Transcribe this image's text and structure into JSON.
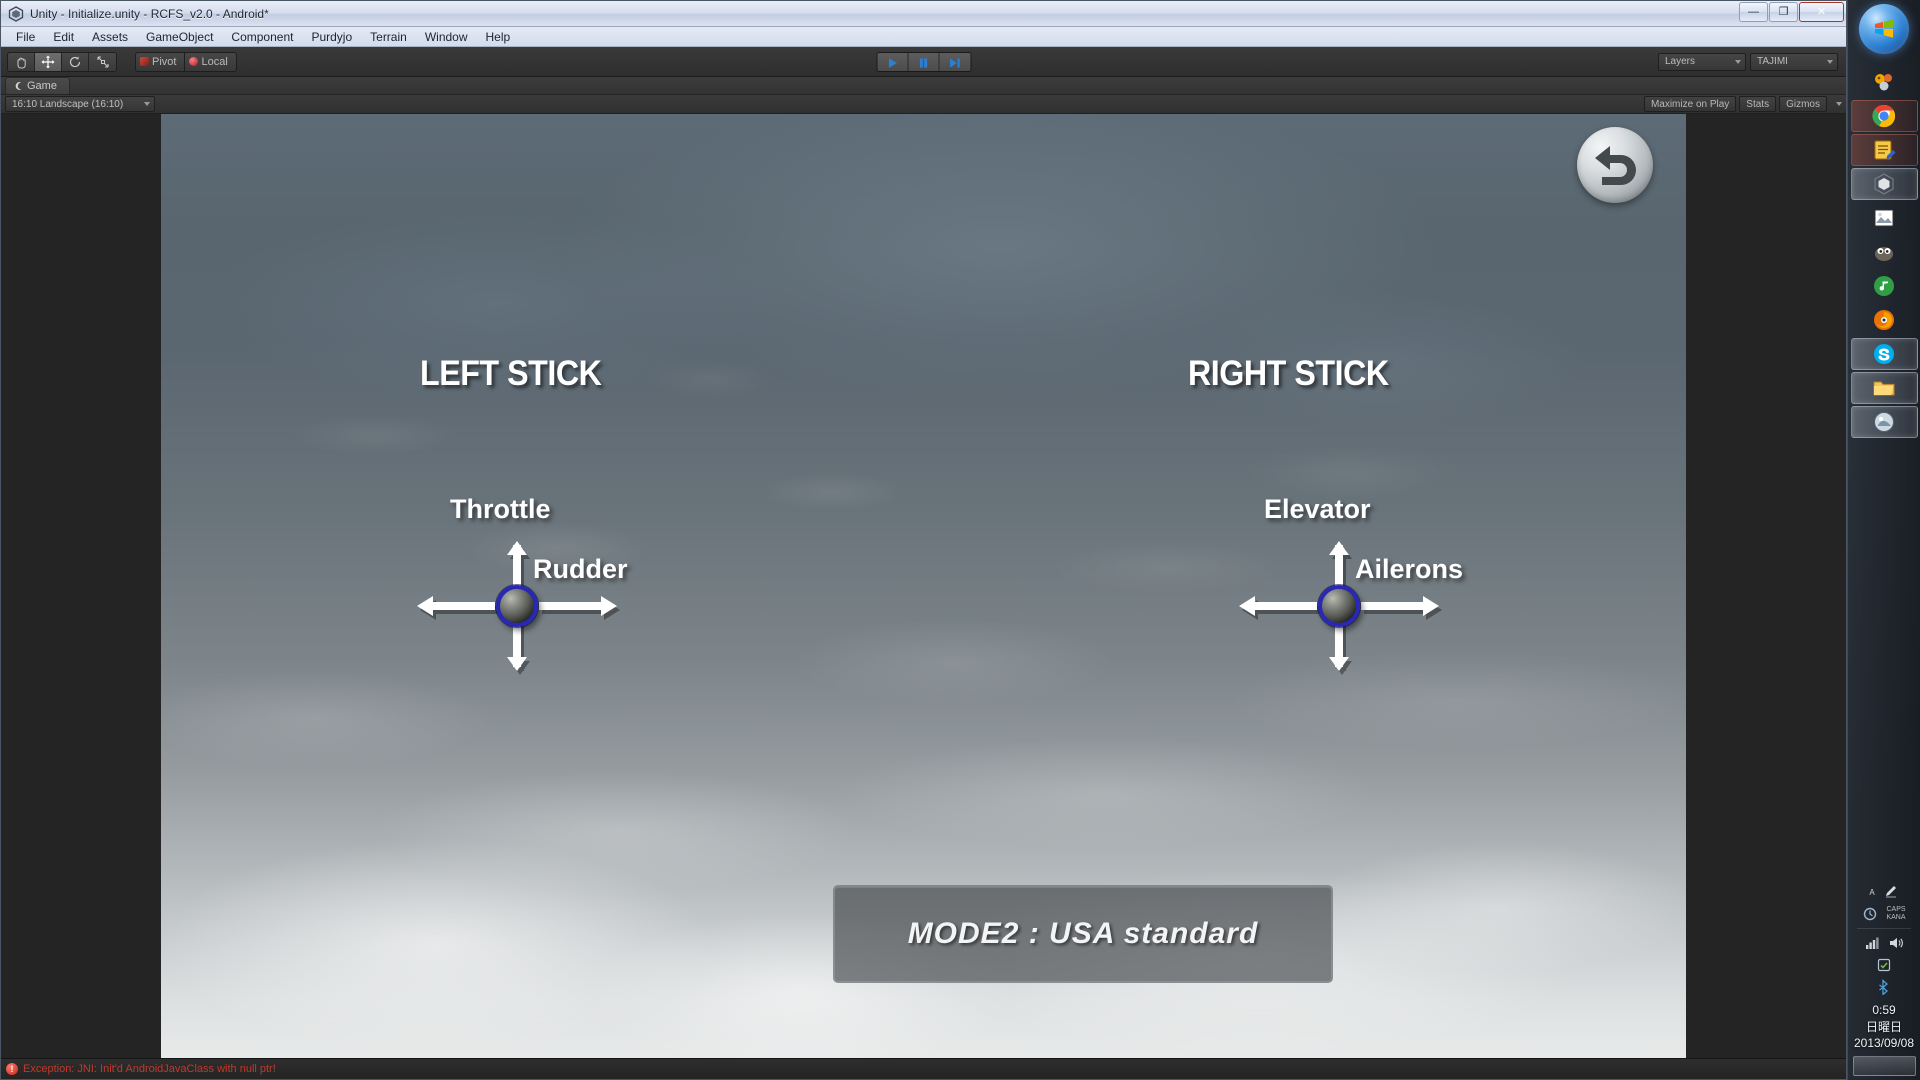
{
  "window": {
    "title": "Unity - Initialize.unity - RCFS_v2.0 - Android*",
    "icon": "unity-logo-icon",
    "minimize_label": "—",
    "maximize_label": "❐",
    "close_label": "✕"
  },
  "menu": {
    "items": [
      {
        "label": "File"
      },
      {
        "label": "Edit"
      },
      {
        "label": "Assets"
      },
      {
        "label": "GameObject"
      },
      {
        "label": "Component"
      },
      {
        "label": "Purdyjo"
      },
      {
        "label": "Terrain"
      },
      {
        "label": "Window"
      },
      {
        "label": "Help"
      }
    ]
  },
  "toolbar": {
    "transform_tools": [
      {
        "name": "hand-tool",
        "selected": false
      },
      {
        "name": "move-tool",
        "selected": true
      },
      {
        "name": "rotate-tool",
        "selected": false
      },
      {
        "name": "scale-tool",
        "selected": false
      }
    ],
    "pivot_label": "Pivot",
    "local_label": "Local",
    "play_controls": [
      {
        "name": "play-button",
        "active": true
      },
      {
        "name": "pause-button",
        "active": true
      },
      {
        "name": "step-button",
        "active": true
      }
    ],
    "layers_label": "Layers",
    "layout_label": "TAJIMI"
  },
  "game_view": {
    "tab_label": "Game",
    "aspect_label": "16:10 Landscape (16:10)",
    "maximize_on_play_label": "Maximize on Play",
    "stats_label": "Stats",
    "gizmos_label": "Gizmos"
  },
  "hud": {
    "left_stick_title": "LEFT STICK",
    "right_stick_title": "RIGHT STICK",
    "left_vertical_label": "Throttle",
    "left_horizontal_label": "Rudder",
    "right_vertical_label": "Elevator",
    "right_horizontal_label": "Ailerons",
    "mode_text": "MODE2 : USA standard",
    "back_button_name": "back-arrow-button",
    "knob_ring_color": "#2828b4",
    "text_color": "#ffffff"
  },
  "status": {
    "error_badge": "!",
    "error_text": "Exception: JNI: Init'd AndroidJavaClass with null ptr!",
    "error_color": "#c0392b"
  },
  "taskbar": {
    "start_label": "start-orb",
    "items": [
      {
        "name": "taskbar-item-paint-tool",
        "state": "normal"
      },
      {
        "name": "taskbar-item-google-chrome",
        "state": "warm"
      },
      {
        "name": "taskbar-item-notepad-editor",
        "state": "warm"
      },
      {
        "name": "taskbar-item-unity",
        "state": "active"
      },
      {
        "name": "taskbar-item-image-viewer",
        "state": "normal"
      },
      {
        "name": "taskbar-item-gimp",
        "state": "normal"
      },
      {
        "name": "taskbar-item-media-player",
        "state": "normal"
      },
      {
        "name": "taskbar-item-firefox",
        "state": "normal"
      },
      {
        "name": "taskbar-item-skype",
        "state": "active"
      },
      {
        "name": "taskbar-item-file-explorer",
        "state": "active"
      },
      {
        "name": "taskbar-item-photo-app",
        "state": "active"
      }
    ],
    "tray": {
      "ime_mode": "A",
      "caps_label": "CAPS",
      "kana_label": "KANA",
      "time": "0:59",
      "day": "日曜日",
      "date": "2013/09/08"
    }
  }
}
